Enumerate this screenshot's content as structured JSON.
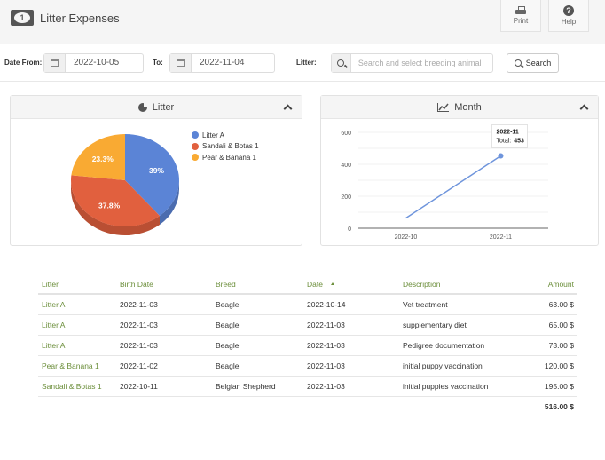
{
  "header": {
    "title": "Litter Expenses",
    "icon": "money-bill-icon",
    "print_label": "Print",
    "help_label": "Help"
  },
  "filters": {
    "date_from_label": "Date From:",
    "date_from_value": "2022-10-05",
    "to_label": "To:",
    "to_value": "2022-11-04",
    "litter_label": "Litter:",
    "litter_placeholder": "Search and select breeding animal",
    "search_button": "Search"
  },
  "panels": {
    "litter_title": "Litter",
    "month_title": "Month"
  },
  "chart_data": [
    {
      "type": "pie",
      "title": "Litter",
      "categories": [
        "Litter A",
        "Sandali & Botas 1",
        "Pear & Banana 1"
      ],
      "values": [
        39,
        37.8,
        23.3
      ],
      "labels": [
        "39%",
        "37.8%",
        "23.3%"
      ],
      "colors": [
        "#5b84d6",
        "#e1603e",
        "#f9aa33"
      ],
      "legend": "right"
    },
    {
      "type": "line",
      "title": "Month",
      "x": [
        "2022-10",
        "2022-11"
      ],
      "series": [
        {
          "name": "Total",
          "values": [
            63,
            453
          ],
          "color": "#6f95dc"
        }
      ],
      "yticks": [
        0,
        200,
        400,
        600
      ],
      "ylim": [
        0,
        600
      ],
      "grid": true,
      "tooltip": {
        "title": "2022-11",
        "label": "Total:",
        "value": "453"
      }
    }
  ],
  "table": {
    "columns": [
      "Litter",
      "Birth Date",
      "Breed",
      "Date",
      "Description",
      "Amount"
    ],
    "sorted_column": "Date",
    "rows": [
      [
        "Litter A",
        "2022-11-03",
        "Beagle",
        "2022-10-14",
        "Vet treatment",
        "63.00 $"
      ],
      [
        "Litter A",
        "2022-11-03",
        "Beagle",
        "2022-11-03",
        "supplementary diet",
        "65.00 $"
      ],
      [
        "Litter A",
        "2022-11-03",
        "Beagle",
        "2022-11-03",
        "Pedigree documentation",
        "73.00 $"
      ],
      [
        "Pear & Banana 1",
        "2022-11-02",
        "Beagle",
        "2022-11-03",
        "initial puppy vaccination",
        "120.00 $"
      ],
      [
        "Sandali & Botas 1",
        "2022-10-11",
        "Belgian Shepherd",
        "2022-11-03",
        "initial puppies vaccination",
        "195.00 $"
      ]
    ],
    "total": "516.00 $"
  }
}
